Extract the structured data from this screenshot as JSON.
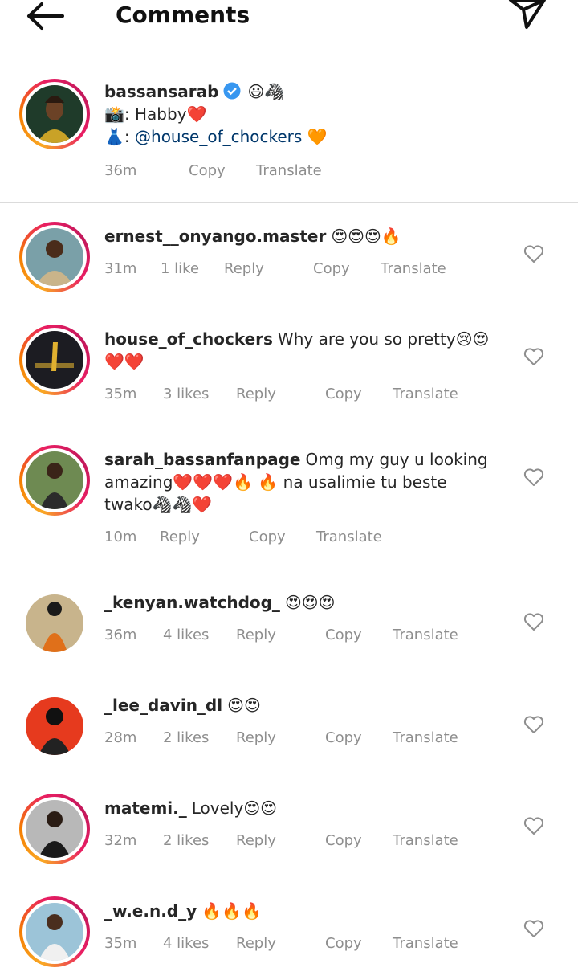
{
  "header": {
    "title": "Comments"
  },
  "caption": {
    "username": "bassansarab",
    "emojis": "😃🦓",
    "line1_icon": "📸",
    "line1_text": ": Habby❤️",
    "line2_icon": "👗",
    "line2_prefix": ":",
    "line2_mention": "@house_of_chockers",
    "line2_emoji": "🧡",
    "time": "36m",
    "copy_label": "Copy",
    "translate_label": "Translate"
  },
  "comments": [
    {
      "username": "ernest__onyango.master",
      "text": "😍😍😍🔥",
      "time": "31m",
      "likes": "1 like",
      "reply": "Reply",
      "copy": "Copy",
      "translate": "Translate"
    },
    {
      "username": "house_of_chockers",
      "text": "Why are you so pretty😢😍",
      "text2": "❤️❤️",
      "time": "35m",
      "likes": "3 likes",
      "reply": "Reply",
      "copy": "Copy",
      "translate": "Translate"
    },
    {
      "username": "sarah_bassanfanpage",
      "text": "Omg  my guy u looking",
      "text2": "amazing❤️❤️❤️🔥 🔥 na usalimie tu beste",
      "text3": "twako🦓🦓❤️",
      "time": "10m",
      "likes": "",
      "reply": "Reply",
      "copy": "Copy",
      "translate": "Translate"
    },
    {
      "username": "_kenyan.watchdog_",
      "text": "😍😍😍",
      "time": "36m",
      "likes": "4 likes",
      "reply": "Reply",
      "copy": "Copy",
      "translate": "Translate"
    },
    {
      "username": "_lee_davin_dl",
      "text": "😍😍",
      "time": "28m",
      "likes": "2 likes",
      "reply": "Reply",
      "copy": "Copy",
      "translate": "Translate"
    },
    {
      "username": "matemi._",
      "text": "Lovely😍😍",
      "time": "32m",
      "likes": "2 likes",
      "reply": "Reply",
      "copy": "Copy",
      "translate": "Translate"
    },
    {
      "username": "_w.e.n.d_y",
      "text": "🔥🔥🔥",
      "time": "35m",
      "likes": "4 likes",
      "reply": "Reply",
      "copy": "Copy",
      "translate": "Translate"
    }
  ],
  "icons": {
    "back": "arrow-left-icon",
    "share": "paper-plane-icon",
    "heart": "heart-outline-icon",
    "verified": "verified-badge-icon"
  },
  "colors": {
    "verified": "#3897f0",
    "secondary_text": "#8e8e8e",
    "mention": "#00376b"
  }
}
